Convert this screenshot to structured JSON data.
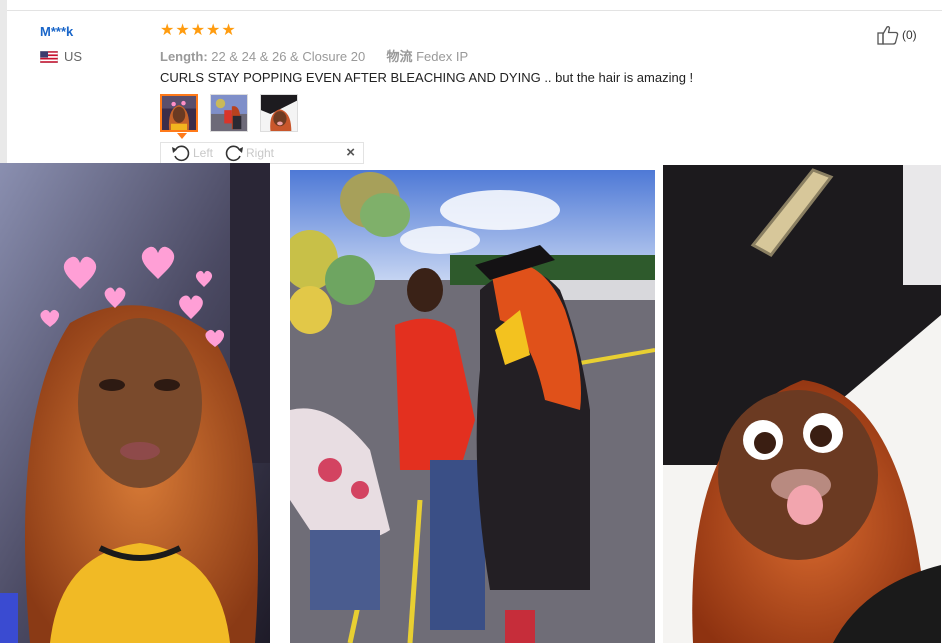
{
  "review": {
    "user": {
      "name": "M***k",
      "country": "US"
    },
    "rating": {
      "stars": 5,
      "max": 5
    },
    "meta": {
      "length_label": "Length:",
      "length_value": "22 & 24 & 26 & Closure 20",
      "logistics_label": "物流",
      "logistics_value": "Fedex IP"
    },
    "text": "CURLS STAY POPPING EVEN AFTER BLEACHING AND DYING .. but the hair is amazing !",
    "likes": {
      "count_label": "(0)",
      "icon": "thumbs-up-icon"
    },
    "thumbnails": {
      "count": 3,
      "active_index": 0
    },
    "viewer": {
      "rotate_left_label": "Left",
      "rotate_right_label": "Right",
      "close_icon": "close-icon",
      "close_glyph": "×"
    }
  },
  "colors": {
    "username": "#1a66c9",
    "star": "#ff9c10",
    "active_thumb_border": "#ff7a1a",
    "muted_text": "#999999"
  }
}
